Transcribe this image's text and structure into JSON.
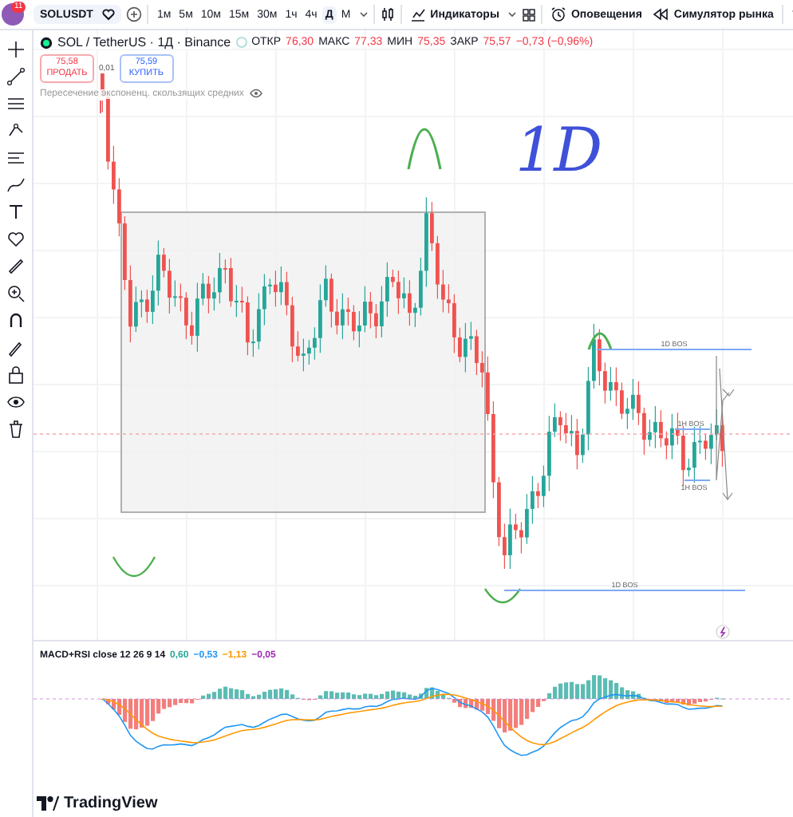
{
  "header": {
    "notifications": "11",
    "symbol": "SOLUSDT",
    "intervals": [
      {
        "label": "1м",
        "selected": false
      },
      {
        "label": "5м",
        "selected": false
      },
      {
        "label": "10м",
        "selected": false
      },
      {
        "label": "15м",
        "selected": false
      },
      {
        "label": "30м",
        "selected": false
      },
      {
        "label": "1ч",
        "selected": false
      },
      {
        "label": "4ч",
        "selected": false
      },
      {
        "label": "Д",
        "selected": true
      },
      {
        "label": "М",
        "selected": false
      }
    ],
    "indicators_button": "Индикаторы",
    "alerts_button": "Оповещения",
    "replay_button": "Симулятор рынка"
  },
  "legend": {
    "title": "SOL / TetherUS · 1Д · Binance",
    "ohlc": [
      {
        "label": "ОТКР",
        "value": "76,30"
      },
      {
        "label": "МАКС",
        "value": "77,33"
      },
      {
        "label": "МИН",
        "value": "75,35"
      },
      {
        "label": "ЗАКР",
        "value": "75,57"
      }
    ],
    "change": "−0,73 (−0,96%)",
    "sell": {
      "price": "75,58",
      "label": "ПРОДАТЬ"
    },
    "spread": "0,01",
    "buy": {
      "price": "75,59",
      "label": "КУПИТЬ"
    },
    "indicator": "Пересечение экспоненц. скользящих средних"
  },
  "annotations": {
    "handwriting": "1D",
    "labels": [
      {
        "text": "1D BOS",
        "kind": "top"
      },
      {
        "text": "1H BOS",
        "kind": "mid"
      },
      {
        "text": "1H BOS",
        "kind": "low"
      },
      {
        "text": "1D BOS",
        "kind": "bottom"
      }
    ]
  },
  "macd": {
    "name": "MACD+RSI close 12 26 9 14",
    "values": [
      {
        "text": "0,60",
        "color": "#26a69a"
      },
      {
        "text": "−0,53",
        "color": "#2196f3"
      },
      {
        "text": "−1,13",
        "color": "#ff9800"
      },
      {
        "text": "−0,05",
        "color": "#9c27b0"
      }
    ]
  },
  "logo": "TradingView"
}
